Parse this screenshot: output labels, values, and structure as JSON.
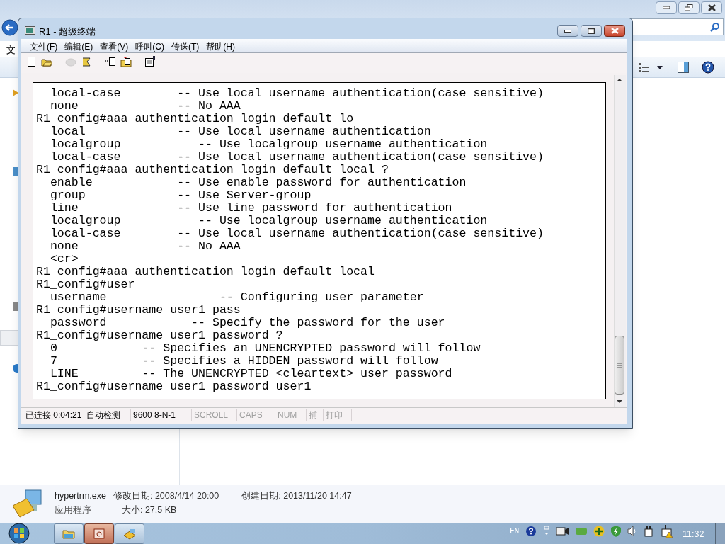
{
  "explorer": {
    "menu_fragment": "文",
    "details": {
      "file_name": "hypertrm.exe",
      "modified": "修改日期: 2008/4/14 20:00",
      "created": "创建日期: 2013/11/20 14:47",
      "type": "应用程序",
      "size": "大小: 27.5 KB"
    }
  },
  "window": {
    "title": "R1 - 超级终端"
  },
  "menu": [
    "文件(F)",
    "编辑(E)",
    "查看(V)",
    "呼叫(C)",
    "传送(T)",
    "帮助(H)"
  ],
  "toolbar": [
    {
      "kind": "new",
      "disabled": false
    },
    {
      "kind": "open",
      "disabled": false
    },
    {
      "kind": "gap"
    },
    {
      "kind": "disconnect",
      "disabled": true
    },
    {
      "kind": "dial",
      "disabled": false
    },
    {
      "kind": "gap"
    },
    {
      "kind": "send",
      "disabled": false
    },
    {
      "kind": "receive",
      "disabled": false
    },
    {
      "kind": "gap"
    },
    {
      "kind": "properties",
      "disabled": false
    }
  ],
  "terminal_lines": [
    "  local-case        -- Use local username authentication(case sensitive)",
    "  none              -- No AAA",
    "R1_config#aaa authentication login default lo",
    "  local             -- Use local username authentication",
    "  localgroup           -- Use localgroup username authentication",
    "  local-case        -- Use local username authentication(case sensitive)",
    "R1_config#aaa authentication login default local ?",
    "  enable            -- Use enable password for authentication",
    "  group             -- Use Server-group",
    "  line              -- Use line password for authentication",
    "  localgroup           -- Use localgroup username authentication",
    "  local-case        -- Use local username authentication(case sensitive)",
    "  none              -- No AAA",
    "  <cr>",
    "R1_config#aaa authentication login default local",
    "R1_config#user",
    "  username                -- Configuring user parameter",
    "R1_config#username user1 pass",
    "  password            -- Specify the password for the user",
    "R1_config#username user1 password ?",
    "  0            -- Specifies an UNENCRYPTED password will follow",
    "  7            -- Specifies a HIDDEN password will follow",
    "  LINE         -- The UNENCRYPTED <cleartext> user password",
    "R1_config#username user1 password user1"
  ],
  "status_bar": [
    {
      "text": "已连接 0:04:21",
      "disabled": false
    },
    {
      "text": "自动检测",
      "disabled": false
    },
    {
      "text": "9600 8-N-1",
      "disabled": false
    },
    {
      "text": "SCROLL",
      "disabled": true
    },
    {
      "text": "CAPS",
      "disabled": true
    },
    {
      "text": "NUM",
      "disabled": true
    },
    {
      "text": "捕",
      "disabled": true
    },
    {
      "text": "打印",
      "disabled": true
    }
  ],
  "taskbar": {
    "buttons": [
      {
        "kind": "folder",
        "selected": false
      },
      {
        "kind": "app",
        "selected": true
      },
      {
        "kind": "phone",
        "selected": false
      }
    ],
    "language": "EN",
    "clock": "11:32"
  }
}
